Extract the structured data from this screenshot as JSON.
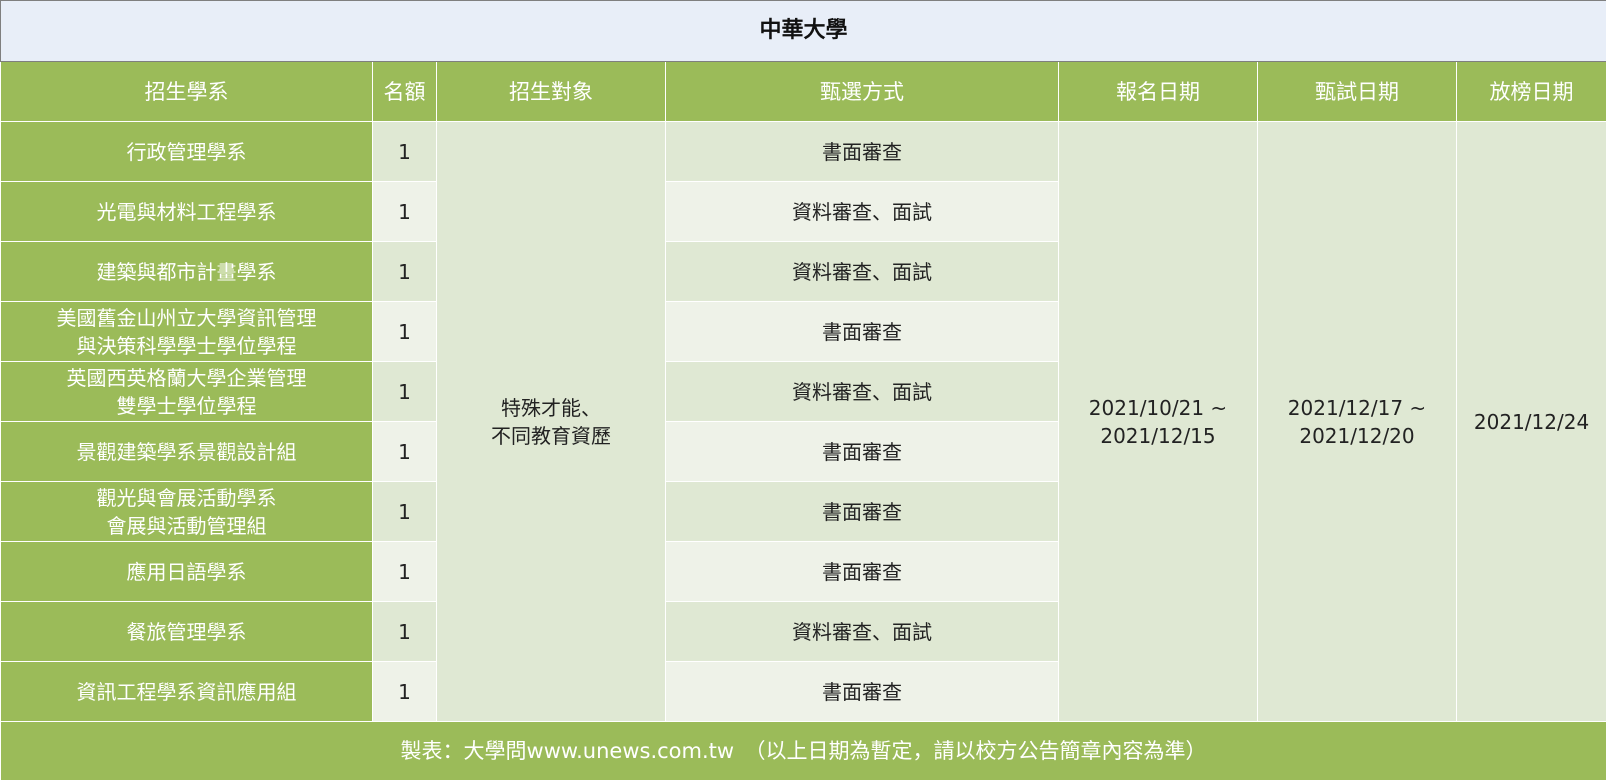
{
  "title": "中華大學",
  "headers": [
    "招生學系",
    "名額",
    "招生對象",
    "甄選方式",
    "報名日期",
    "甄試日期",
    "放榜日期"
  ],
  "rows": [
    {
      "dept": [
        "行政管理學系"
      ],
      "quota": "1",
      "method": "書面審查"
    },
    {
      "dept": [
        "光電與材料工程學系"
      ],
      "quota": "1",
      "method": "資料審查、面試"
    },
    {
      "dept": [
        "建築與都市計畫學系"
      ],
      "quota": "1",
      "method": "資料審查、面試"
    },
    {
      "dept": [
        "美國舊金山州立大學資訊管理",
        "與決策科學學士學位學程"
      ],
      "quota": "1",
      "method": "書面審查"
    },
    {
      "dept": [
        "英國西英格蘭大學企業管理",
        "雙學士學位學程"
      ],
      "quota": "1",
      "method": "資料審查、面試"
    },
    {
      "dept": [
        "景觀建築學系景觀設計組"
      ],
      "quota": "1",
      "method": "書面審查"
    },
    {
      "dept": [
        "觀光與會展活動學系",
        "會展與活動管理組"
      ],
      "quota": "1",
      "method": "書面審查"
    },
    {
      "dept": [
        "應用日語學系"
      ],
      "quota": "1",
      "method": "書面審查"
    },
    {
      "dept": [
        "餐旅管理學系"
      ],
      "quota": "1",
      "method": "資料審查、面試"
    },
    {
      "dept": [
        "資訊工程學系資訊應用組"
      ],
      "quota": "1",
      "method": "書面審查"
    }
  ],
  "target": [
    "特殊才能、",
    "不同教育資歷"
  ],
  "apply_date": [
    "2021/10/21 ~",
    "2021/12/15"
  ],
  "exam_date": [
    "2021/12/17 ~",
    "2021/12/20"
  ],
  "release_date": "2021/12/24",
  "footer": "製表：大學問www.unews.com.tw　（以上日期為暫定，請以校方公告簡章內容為準）"
}
